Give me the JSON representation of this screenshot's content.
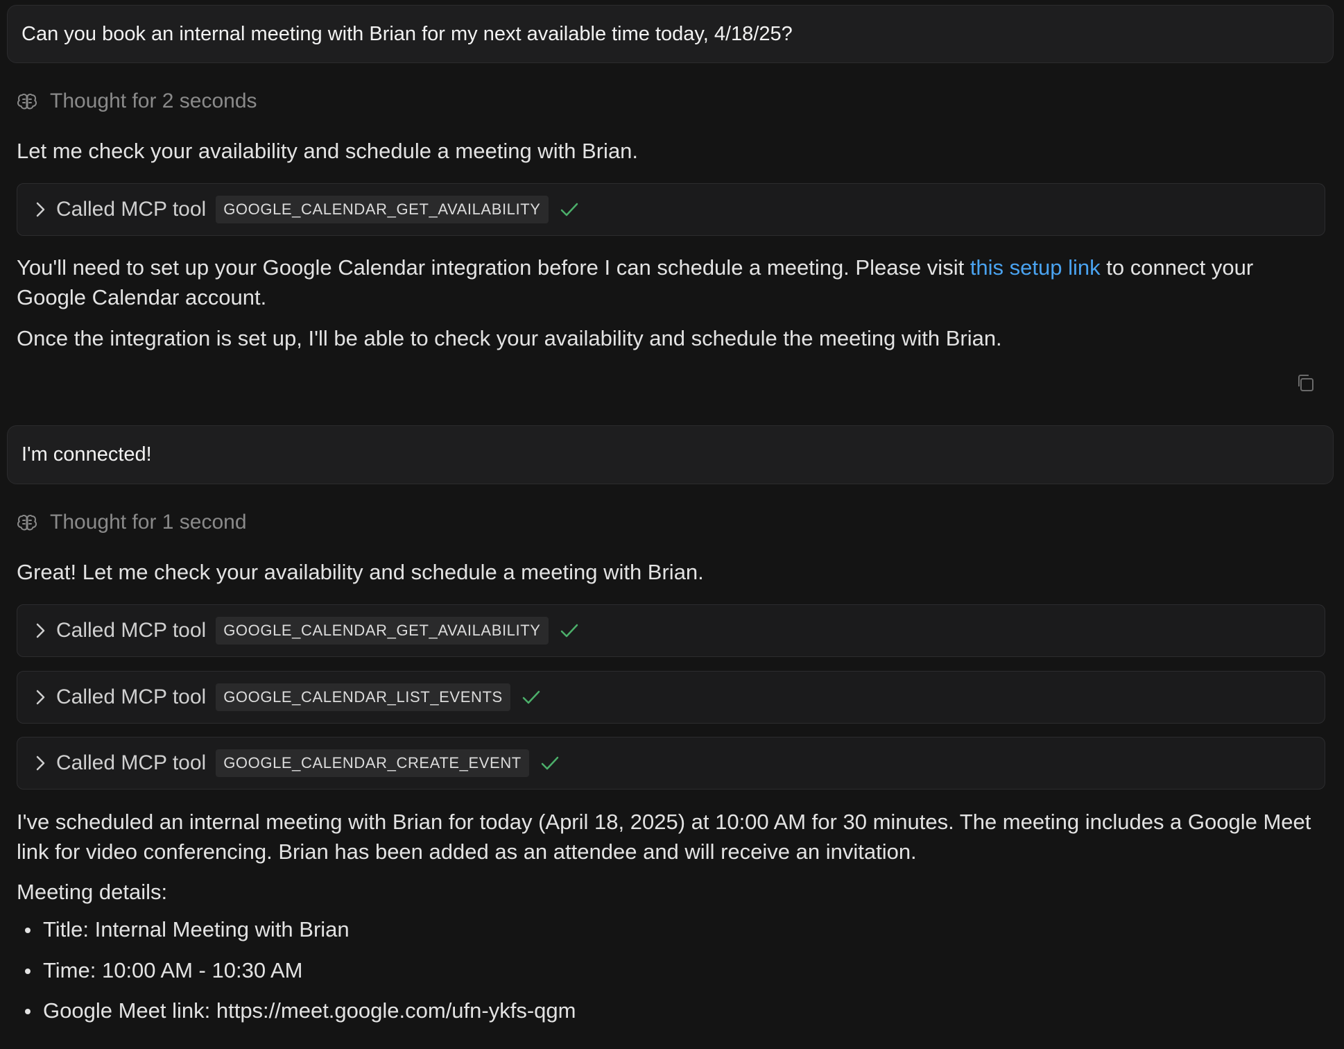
{
  "messages": {
    "user1": "Can you book an internal meeting with Brian for my next available time today, 4/18/25?",
    "thought1": "Thought for 2 seconds",
    "reply1_intro": "Let me check your availability and schedule a meeting with Brian.",
    "tool1": {
      "label": "Called MCP tool",
      "name": "GOOGLE_CALENDAR_GET_AVAILABILITY"
    },
    "reply1_p1_before": "You'll need to set up your Google Calendar integration before I can schedule a meeting. Please visit ",
    "reply1_link": "this setup link",
    "reply1_p1_after": " to connect your Google Calendar account.",
    "reply1_p2": "Once the integration is set up, I'll be able to check your availability and schedule the meeting with Brian.",
    "user2": "I'm connected!",
    "thought2": "Thought for 1 second",
    "reply2_intro": "Great! Let me check your availability and schedule a meeting with Brian.",
    "tools2": [
      {
        "label": "Called MCP tool",
        "name": "GOOGLE_CALENDAR_GET_AVAILABILITY"
      },
      {
        "label": "Called MCP tool",
        "name": "GOOGLE_CALENDAR_LIST_EVENTS"
      },
      {
        "label": "Called MCP tool",
        "name": "GOOGLE_CALENDAR_CREATE_EVENT"
      }
    ],
    "reply2_summary": "I've scheduled an internal meeting with Brian for today (April 18, 2025) at 10:00 AM for 30 minutes. The meeting includes a Google Meet link for video conferencing. Brian has been added as an attendee and will receive an invitation.",
    "details_heading": "Meeting details:",
    "details": [
      "Title: Internal Meeting with Brian",
      "Time: 10:00 AM - 10:30 AM",
      "Google Meet link: https://meet.google.com/ufn-ykfs-qgm"
    ]
  },
  "icons": {
    "thought": "brain-icon",
    "tool_expand": "chevron-right-icon",
    "tool_status": "checkmark-icon",
    "copy": "copy-icon"
  },
  "colors": {
    "background": "#141414",
    "link": "#4aa3f0",
    "success_check": "#4caf6a"
  }
}
